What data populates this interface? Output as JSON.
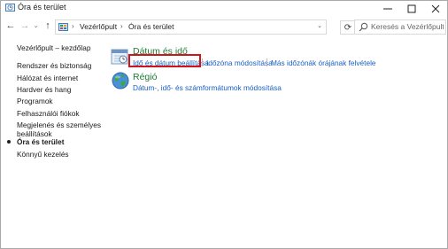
{
  "window": {
    "title": "Óra és terület",
    "controls": {
      "minimize": "—",
      "maximize": "☐",
      "close": "✕"
    }
  },
  "nav": {
    "back": "←",
    "forward": "→",
    "recent": "⌄",
    "up": "↑",
    "breadcrumb": [
      "Vezérlőpult",
      "Óra és terület"
    ],
    "separator": "›",
    "refresh": "⟳",
    "dropdown": "⌄",
    "search_placeholder": "Keresés a Vezérlőpulton"
  },
  "sidebar": {
    "items": [
      {
        "label": "Vezérlőpult – kezdőlap",
        "active": false
      },
      {
        "label": "Rendszer és biztonság",
        "active": false
      },
      {
        "label": "Hálózat és internet",
        "active": false
      },
      {
        "label": "Hardver és hang",
        "active": false
      },
      {
        "label": "Programok",
        "active": false
      },
      {
        "label": "Felhasználói fiókok",
        "active": false
      },
      {
        "label": "Megjelenés és személyes",
        "active": false
      },
      {
        "label": "beállítások",
        "active": false
      },
      {
        "label": "Óra és terület",
        "active": true
      },
      {
        "label": "Könnyű kezelés",
        "active": false
      }
    ]
  },
  "main": {
    "datetime": {
      "title": "Dátum és idő",
      "links": [
        "Idő és dátum beállítása",
        "Időzóna módosítása",
        "Más időzónák órájának felvétele"
      ]
    },
    "region": {
      "title": "Régió",
      "links": [
        "Dátum-, idő- és számformátumok módosítása"
      ]
    }
  },
  "colors": {
    "link": "#1b5fc1",
    "category_title": "#1e7c34",
    "highlight_border": "#d0141b"
  }
}
